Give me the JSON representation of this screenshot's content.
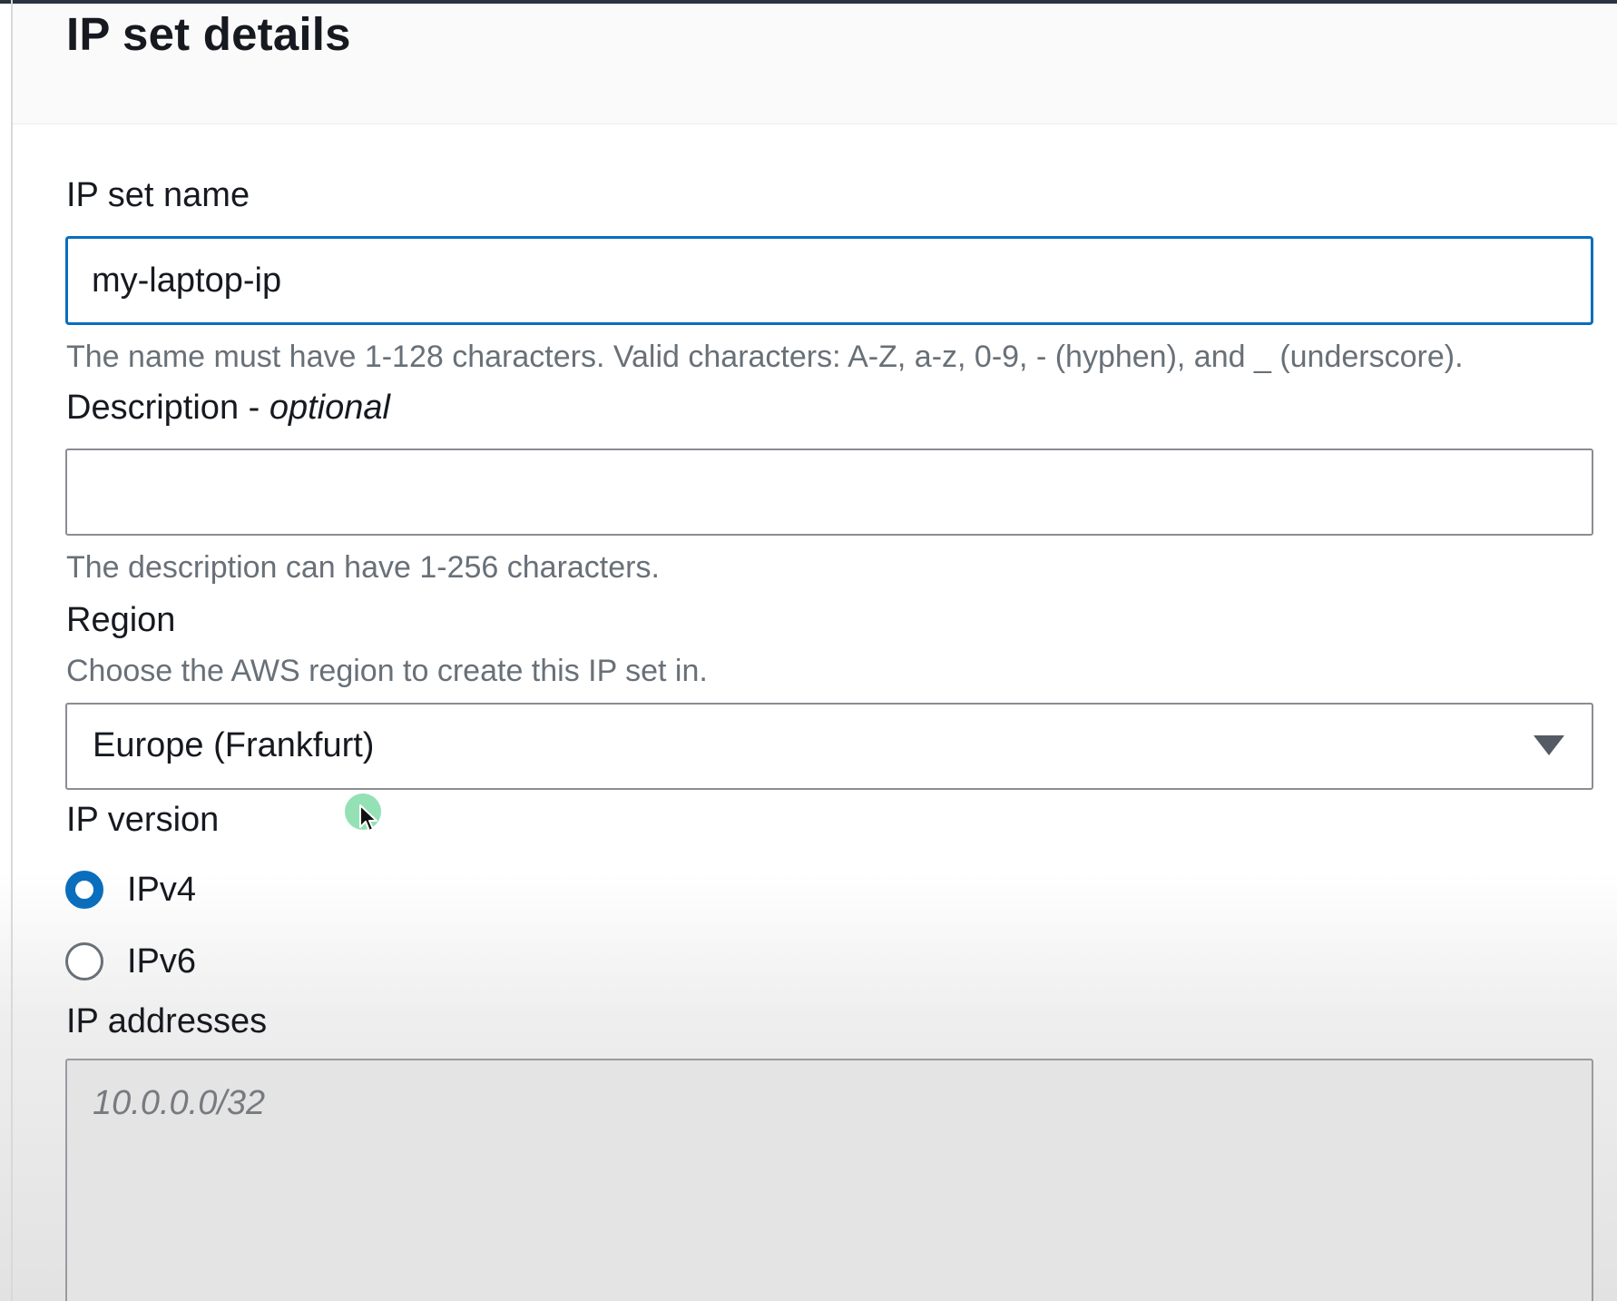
{
  "header": {
    "title": "IP set details"
  },
  "ip_set_name": {
    "label": "IP set name",
    "value": "my-laptop-ip",
    "hint": "The name must have 1-128 characters. Valid characters: A-Z, a-z, 0-9, - (hyphen), and _ (underscore)."
  },
  "description": {
    "label": "Description - ",
    "label_optional": "optional",
    "value": "",
    "hint": "The description can have 1-256 characters."
  },
  "region": {
    "label": "Region",
    "hint": "Choose the AWS region to create this IP set in.",
    "selected": "Europe (Frankfurt)"
  },
  "ip_version": {
    "label": "IP version",
    "options": [
      {
        "label": "IPv4",
        "checked": true
      },
      {
        "label": "IPv6",
        "checked": false
      }
    ]
  },
  "ip_addresses": {
    "label": "IP addresses",
    "placeholder": "10.0.0.0/32"
  },
  "colors": {
    "accent": "#0a6ebd",
    "text": "#16191f",
    "hint": "#687078",
    "cursor_halo": "#3cc878"
  },
  "icons": {
    "region_caret": "caret-down-icon",
    "pointer": "mouse-pointer-icon"
  }
}
